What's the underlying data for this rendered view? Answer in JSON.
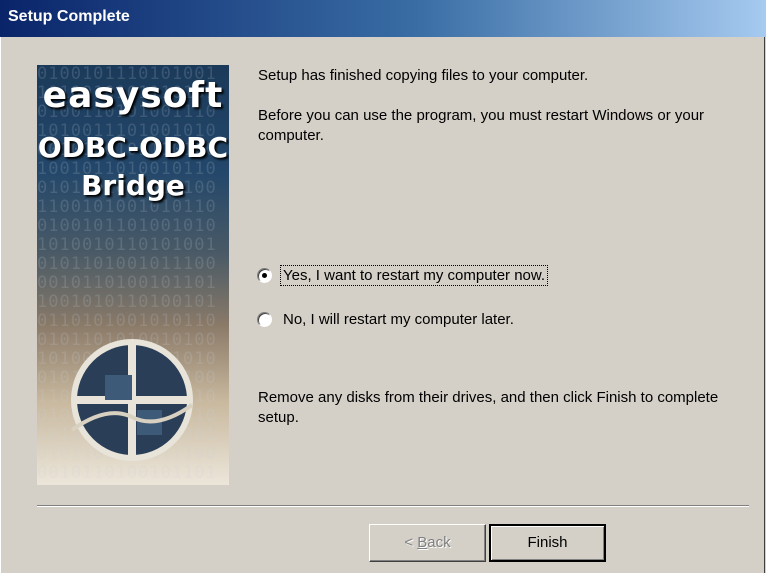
{
  "window": {
    "title": "Setup Complete"
  },
  "banner": {
    "brand_line1": "easysoft",
    "brand_line2": "ODBC-ODBC",
    "brand_line3": "Bridge"
  },
  "content": {
    "line1": "Setup has finished copying files to your computer.",
    "line2": "Before you can use the program, you must restart Windows or your computer.",
    "radio_options": [
      {
        "label": "Yes, I want to restart my computer now.",
        "selected": true
      },
      {
        "label": "No, I will restart my computer later.",
        "selected": false
      }
    ],
    "line3": "Remove any disks from their drives, and then click Finish to complete setup."
  },
  "buttons": {
    "back_prefix": "< ",
    "back_accel": "B",
    "back_rest": "ack",
    "back_enabled": false,
    "finish_label": "Finish"
  }
}
